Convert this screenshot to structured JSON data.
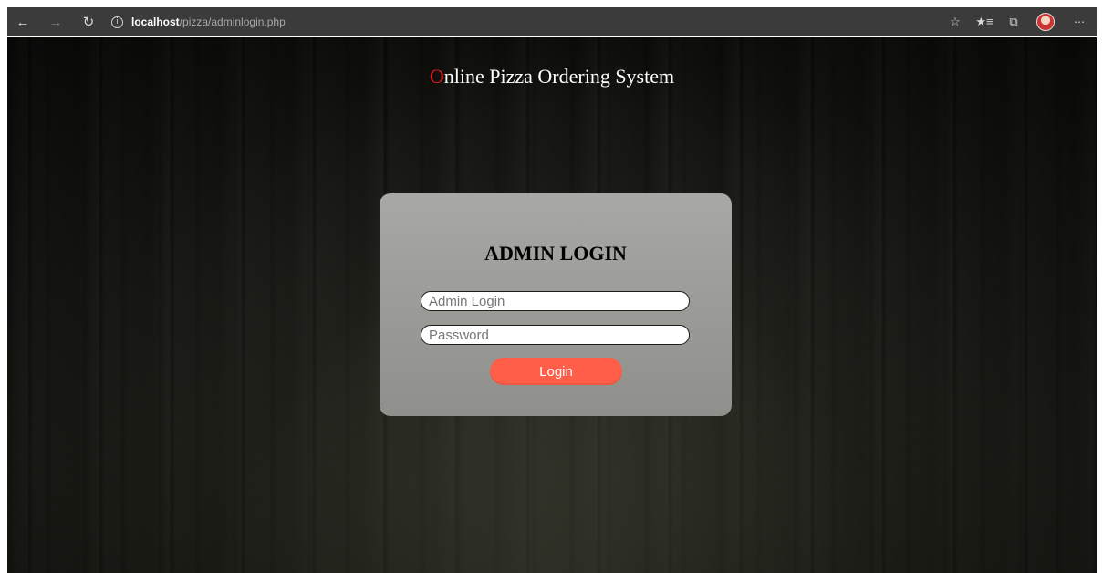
{
  "browser": {
    "url_host": "localhost",
    "url_path": "/pizza/adminlogin.php",
    "icons": {
      "back": "arrow-left-icon",
      "forward": "arrow-right-icon",
      "refresh": "refresh-icon",
      "info": "info-icon",
      "favorite": "star-icon",
      "favorites_list": "favorites-list-icon",
      "collections": "collections-icon",
      "profile": "avatar",
      "menu": "ellipsis-icon"
    }
  },
  "site": {
    "title_first_letter": "O",
    "title_rest": "nline Pizza Ordering System",
    "accent_color": "#e01b1b"
  },
  "login": {
    "heading": "ADMIN LOGIN",
    "username_placeholder": "Admin Login",
    "username_value": "",
    "password_placeholder": "Password",
    "password_value": "",
    "button_label": "Login",
    "button_color": "#ff5f48"
  }
}
